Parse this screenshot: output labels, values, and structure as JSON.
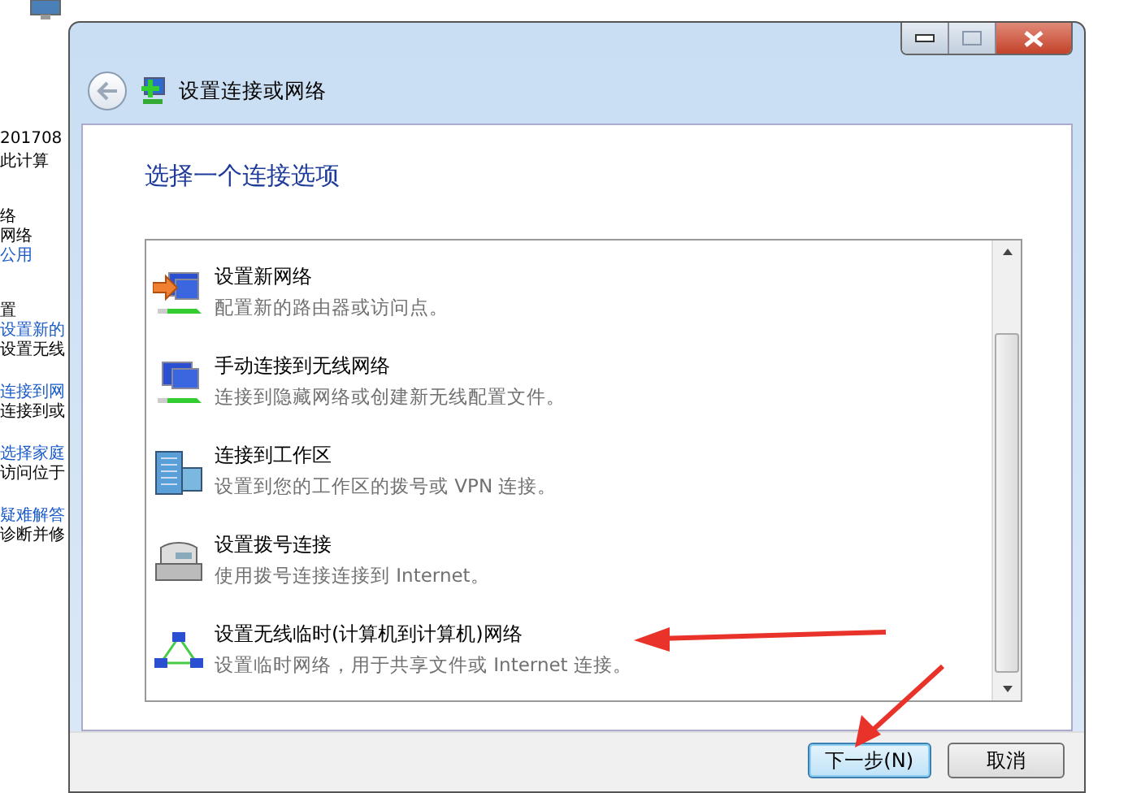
{
  "background_window": {
    "items": [
      {
        "text": "201708",
        "kind": "text"
      },
      {
        "text": "此计算",
        "kind": "text"
      },
      {
        "text": "络",
        "kind": "heading"
      },
      {
        "text": "网络",
        "kind": "text"
      },
      {
        "text": "公用",
        "kind": "link"
      },
      {
        "text": "置",
        "kind": "heading"
      },
      {
        "text": "设置新的",
        "kind": "link"
      },
      {
        "text": "设置无线",
        "kind": "text"
      },
      {
        "text": "连接到网",
        "kind": "link"
      },
      {
        "text": "连接到或",
        "kind": "text"
      },
      {
        "text": "选择家庭",
        "kind": "link"
      },
      {
        "text": "访问位于",
        "kind": "text"
      },
      {
        "text": "疑难解答",
        "kind": "link"
      },
      {
        "text": "诊断并修",
        "kind": "text"
      }
    ]
  },
  "dialog": {
    "title": "设置连接或网络",
    "heading": "选择一个连接选项",
    "options": [
      {
        "kind": "new-network",
        "title": "设置新网络",
        "description": "配置新的路由器或访问点。"
      },
      {
        "kind": "wireless",
        "title": "手动连接到无线网络",
        "description": "连接到隐藏网络或创建新无线配置文件。"
      },
      {
        "kind": "workplace",
        "title": "连接到工作区",
        "description": "设置到您的工作区的拨号或 VPN 连接。"
      },
      {
        "kind": "dialup",
        "title": "设置拨号连接",
        "description": "使用拨号连接连接到 Internet。"
      },
      {
        "kind": "adhoc",
        "title": "设置无线临时(计算机到计算机)网络",
        "description": "设置临时网络，用于共享文件或 Internet 连接。"
      }
    ],
    "buttons": [
      {
        "label": "下一步(N)",
        "default": true
      },
      {
        "label": "取消",
        "default": false
      }
    ]
  }
}
